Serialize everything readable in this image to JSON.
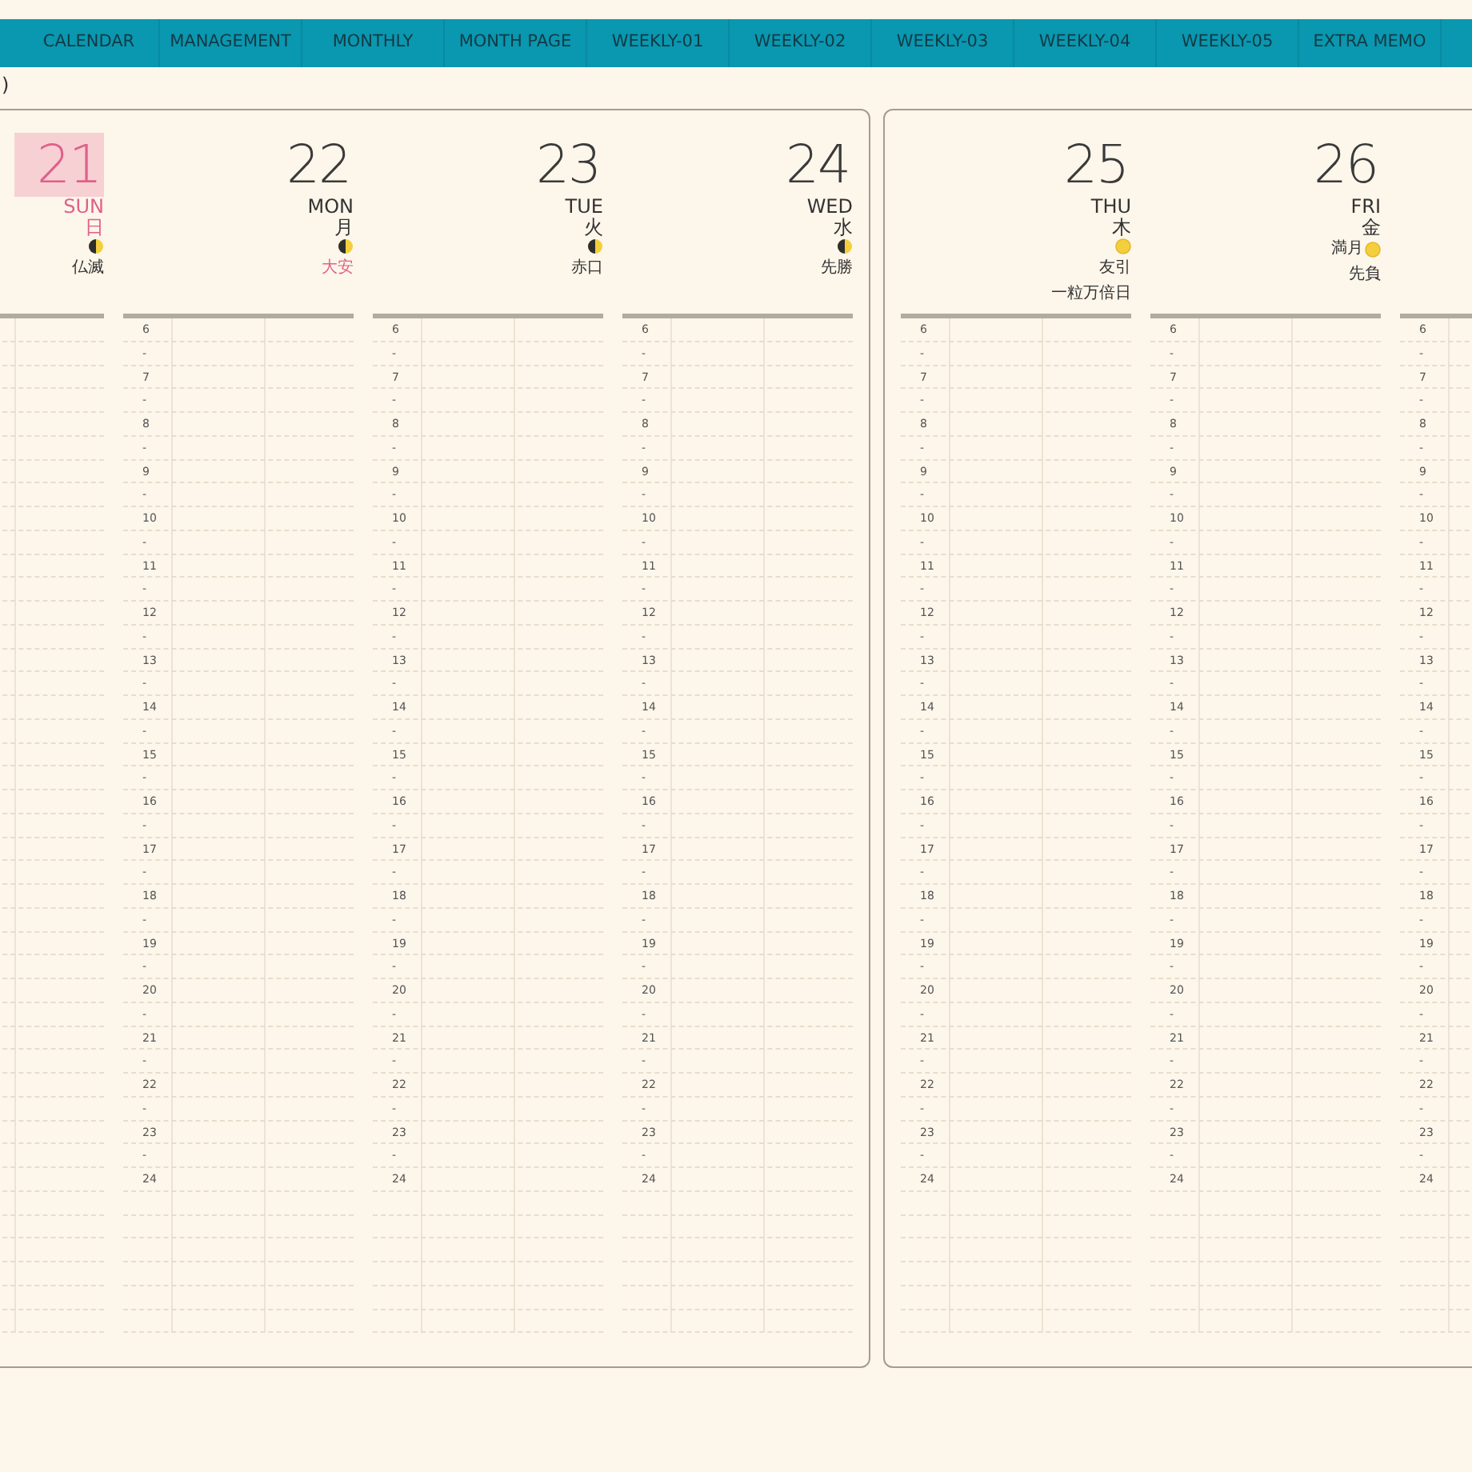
{
  "tabs": [
    {
      "label": "CALENDAR"
    },
    {
      "label": "MANAGEMENT"
    },
    {
      "label": "MONTHLY"
    },
    {
      "label": "MONTH PAGE"
    },
    {
      "label": "WEEKLY-01"
    },
    {
      "label": "WEEKLY-02"
    },
    {
      "label": "WEEKLY-03"
    },
    {
      "label": "WEEKLY-04"
    },
    {
      "label": "WEEKLY-05"
    },
    {
      "label": "EXTRA MEMO"
    }
  ],
  "corner_text": ")",
  "pages": [
    {
      "days": [
        {
          "date": "21",
          "weekday_en": "SUN",
          "weekday_ja": "日",
          "highlighted": true,
          "moon": {
            "kind": "half"
          },
          "rokuyo": "仏滅",
          "rokuyo_highlight": false
        },
        {
          "date": "22",
          "weekday_en": "MON",
          "weekday_ja": "月",
          "highlighted": false,
          "moon": {
            "kind": "half"
          },
          "rokuyo": "大安",
          "rokuyo_highlight": true,
          "hour_labels": [
            "6",
            "-",
            "7",
            "-",
            "8",
            "-",
            "9",
            "-",
            "10",
            "-",
            "11",
            "-",
            "12",
            "-",
            "13",
            "-",
            "14",
            "-",
            "15",
            "-",
            "16",
            "-",
            "17",
            "-",
            "18",
            "-",
            "19",
            "-",
            "20",
            "-",
            "21",
            "-",
            "22",
            "-",
            "23",
            "-",
            "24"
          ]
        },
        {
          "date": "23",
          "weekday_en": "TUE",
          "weekday_ja": "火",
          "highlighted": false,
          "moon": {
            "kind": "half"
          },
          "rokuyo": "赤口",
          "rokuyo_highlight": false,
          "hour_labels": [
            "6",
            "-",
            "7",
            "-",
            "8",
            "-",
            "9",
            "-",
            "10",
            "-",
            "11",
            "-",
            "12",
            "-",
            "13",
            "-",
            "14",
            "-",
            "15",
            "-",
            "16",
            "-",
            "17",
            "-",
            "18",
            "-",
            "19",
            "-",
            "20",
            "-",
            "21",
            "-",
            "22",
            "-",
            "23",
            "-",
            "24"
          ]
        },
        {
          "date": "24",
          "weekday_en": "WED",
          "weekday_ja": "水",
          "highlighted": false,
          "moon": {
            "kind": "half"
          },
          "rokuyo": "先勝",
          "rokuyo_highlight": false,
          "hour_labels": [
            "6",
            "-",
            "7",
            "-",
            "8",
            "-",
            "9",
            "-",
            "10",
            "-",
            "11",
            "-",
            "12",
            "-",
            "13",
            "-",
            "14",
            "-",
            "15",
            "-",
            "16",
            "-",
            "17",
            "-",
            "18",
            "-",
            "19",
            "-",
            "20",
            "-",
            "21",
            "-",
            "22",
            "-",
            "23",
            "-",
            "24"
          ]
        }
      ]
    },
    {
      "days": [
        {
          "date": "25",
          "weekday_en": "THU",
          "weekday_ja": "木",
          "highlighted": false,
          "moon": {
            "kind": "full"
          },
          "rokuyo": "友引",
          "rokuyo_highlight": false,
          "note": "一粒万倍日",
          "hour_labels": [
            "6",
            "-",
            "7",
            "-",
            "8",
            "-",
            "9",
            "-",
            "10",
            "-",
            "11",
            "-",
            "12",
            "-",
            "13",
            "-",
            "14",
            "-",
            "15",
            "-",
            "16",
            "-",
            "17",
            "-",
            "18",
            "-",
            "19",
            "-",
            "20",
            "-",
            "21",
            "-",
            "22",
            "-",
            "23",
            "-",
            "24"
          ]
        },
        {
          "date": "26",
          "weekday_en": "FRI",
          "weekday_ja": "金",
          "highlighted": false,
          "moon": {
            "kind": "full"
          },
          "moon_label": "満月",
          "rokuyo": "先負",
          "rokuyo_highlight": false,
          "hour_labels": [
            "6",
            "-",
            "7",
            "-",
            "8",
            "-",
            "9",
            "-",
            "10",
            "-",
            "11",
            "-",
            "12",
            "-",
            "13",
            "-",
            "14",
            "-",
            "15",
            "-",
            "16",
            "-",
            "17",
            "-",
            "18",
            "-",
            "19",
            "-",
            "20",
            "-",
            "21",
            "-",
            "22",
            "-",
            "23",
            "-",
            "24"
          ]
        },
        {
          "hour_labels": [
            "6",
            "-",
            "7",
            "-",
            "8",
            "-",
            "9",
            "-",
            "10",
            "-",
            "11",
            "-",
            "12",
            "-",
            "13",
            "-",
            "14",
            "-",
            "15",
            "-",
            "16",
            "-",
            "17",
            "-",
            "18",
            "-",
            "19",
            "-",
            "20",
            "-",
            "21",
            "-",
            "22",
            "-",
            "23",
            "-",
            "24"
          ]
        }
      ]
    }
  ]
}
